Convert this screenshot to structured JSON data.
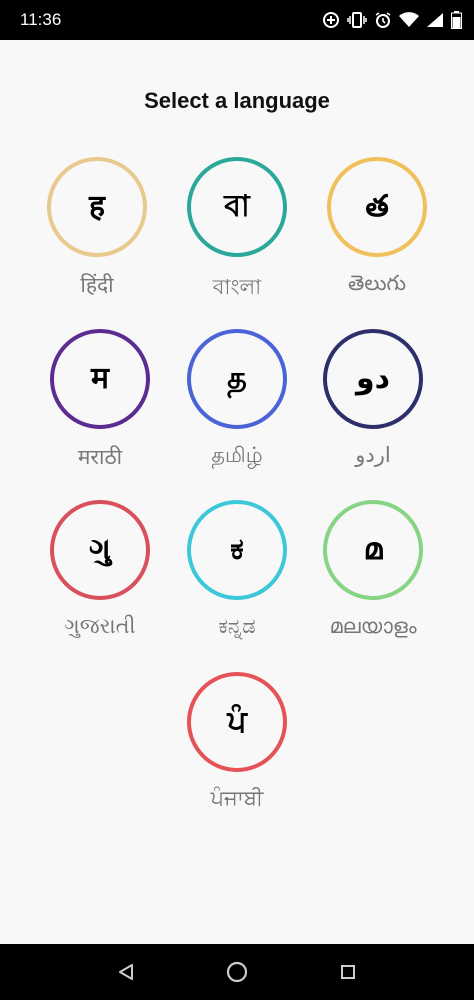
{
  "status_bar": {
    "time": "11:36",
    "icons": [
      "data-saver-icon",
      "vibrate-icon",
      "alarm-icon",
      "wifi-icon",
      "signal-icon",
      "battery-icon"
    ]
  },
  "page": {
    "title": "Select a language"
  },
  "languages": [
    {
      "glyph": "ह",
      "label": "हिंदी",
      "color": "#e8c98e"
    },
    {
      "glyph": "বা",
      "label": "বাংলা",
      "color": "#2aa89a"
    },
    {
      "glyph": "త",
      "label": "తెలుగు",
      "color": "#f0c05a"
    },
    {
      "glyph": "म",
      "label": "मराठी",
      "color": "#5b2d91"
    },
    {
      "glyph": "த",
      "label": "தமிழ்",
      "color": "#4a63d6"
    },
    {
      "glyph": "دو",
      "label": "اردو",
      "color": "#2d2f6b"
    },
    {
      "glyph": "ગુ",
      "label": "ગુજરાતી",
      "color": "#d9505d"
    },
    {
      "glyph": "ಕ",
      "label": "ಕನ್ನಡ",
      "color": "#3cc8d8"
    },
    {
      "glyph": "മ",
      "label": "മലയാളം",
      "color": "#86d484"
    },
    {
      "glyph": "ਪੰ",
      "label": "ਪੰਜਾਬੀ",
      "color": "#e55357"
    }
  ],
  "nav_bar": {
    "icons": [
      "back-icon",
      "home-icon",
      "recents-icon"
    ]
  },
  "colors": {
    "status_bg": "#000000",
    "background": "#f8f8f8",
    "label_text": "#777777"
  }
}
